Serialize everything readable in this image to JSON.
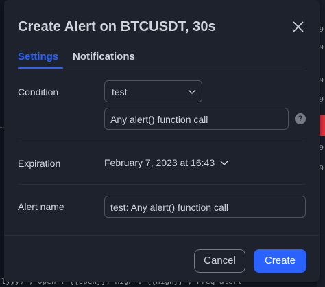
{
  "dialog": {
    "title": "Create Alert on BTCUSDT, 30s",
    "tabs": [
      {
        "label": "Settings",
        "active": true
      },
      {
        "label": "Notifications",
        "active": false
      }
    ],
    "condition": {
      "label": "Condition",
      "selected": "test",
      "message_value": "Any alert() function call",
      "help_glyph": "?"
    },
    "expiration": {
      "label": "Expiration",
      "value": "February 7, 2023 at 16:43"
    },
    "alert_name": {
      "label": "Alert name",
      "value": "test: Any alert() function call"
    },
    "buttons": {
      "cancel": "Cancel",
      "create": "Create"
    }
  },
  "background": {
    "bottom_code": "lyyy) , Open : {{Open}}, High : {{high}} , Freq alert",
    "right_ticks": [
      "9",
      "9",
      "9",
      "9",
      "9",
      "9"
    ]
  },
  "colors": {
    "accent": "#2962ff",
    "dialog_bg": "#1e222d",
    "text": "#d1d4dc",
    "border": "#50535e"
  }
}
